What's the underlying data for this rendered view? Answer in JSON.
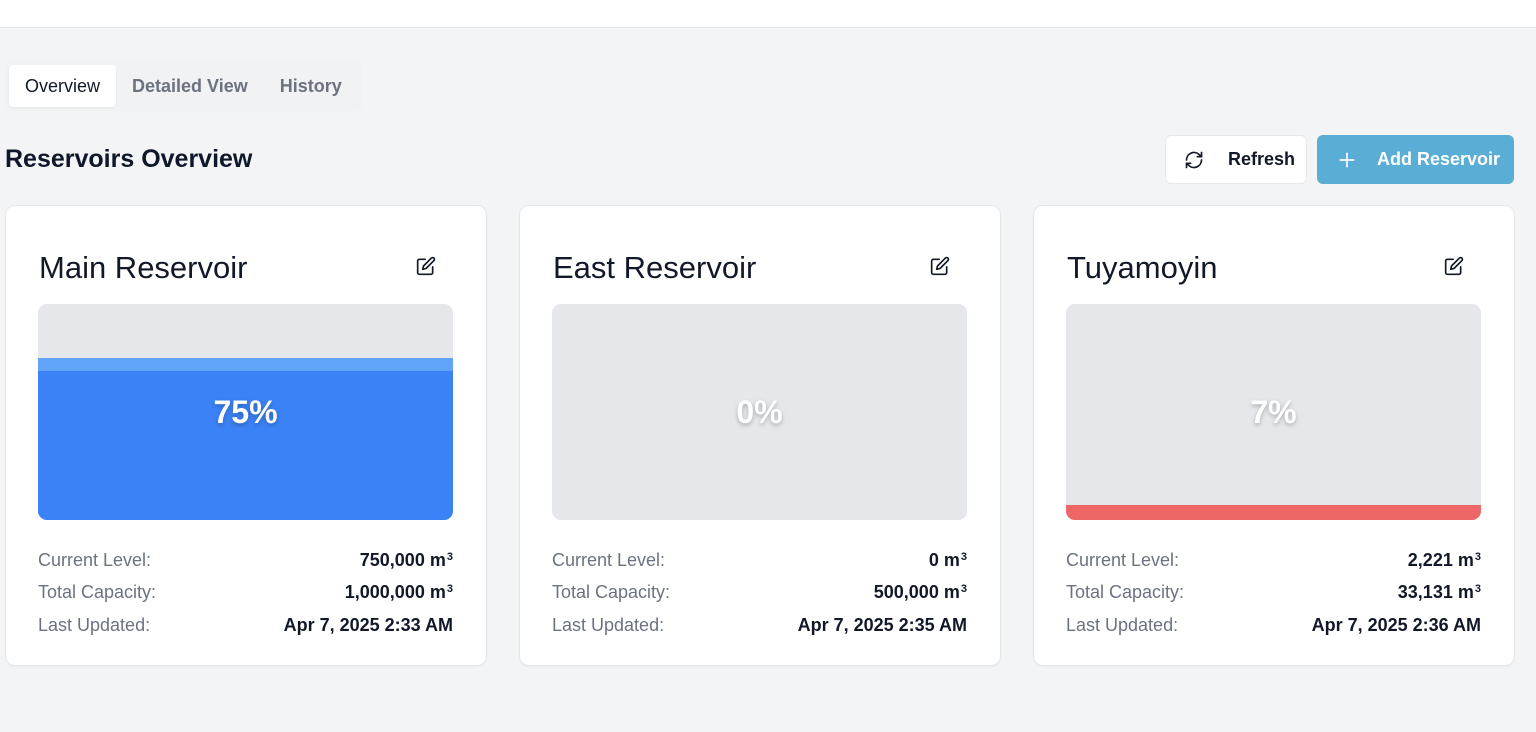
{
  "tabs": [
    {
      "label": "Overview",
      "active": true
    },
    {
      "label": "Detailed View",
      "active": false
    },
    {
      "label": "History",
      "active": false
    }
  ],
  "page_title": "Reservoirs Overview",
  "actions": {
    "refresh_label": "Refresh",
    "refresh_icon": "refresh-icon",
    "add_label": "Add Reservoir",
    "add_icon": "plus-icon",
    "add_color": "#5aaed6"
  },
  "labels": {
    "current_level": "Current Level:",
    "total_capacity": "Total Capacity:",
    "last_updated": "Last Updated:"
  },
  "unit": "m",
  "unit_sup": "3",
  "reservoirs": [
    {
      "name": "Main Reservoir",
      "percent_label": "75%",
      "fill_fraction": 0.75,
      "fill_color": "#3b82f6",
      "current_level": "750,000",
      "total_capacity": "1,000,000",
      "last_updated": "Apr 7, 2025 2:33 AM"
    },
    {
      "name": "East Reservoir",
      "percent_label": "0%",
      "fill_fraction": 0,
      "fill_color": "#3b82f6",
      "current_level": "0",
      "total_capacity": "500,000",
      "last_updated": "Apr 7, 2025 2:35 AM"
    },
    {
      "name": "Tuyamoyin",
      "percent_label": "7%",
      "fill_fraction": 0.07,
      "fill_color": "#ef6666",
      "current_level": "2,221",
      "total_capacity": "33,131",
      "last_updated": "Apr 7, 2025 2:36 AM"
    }
  ]
}
